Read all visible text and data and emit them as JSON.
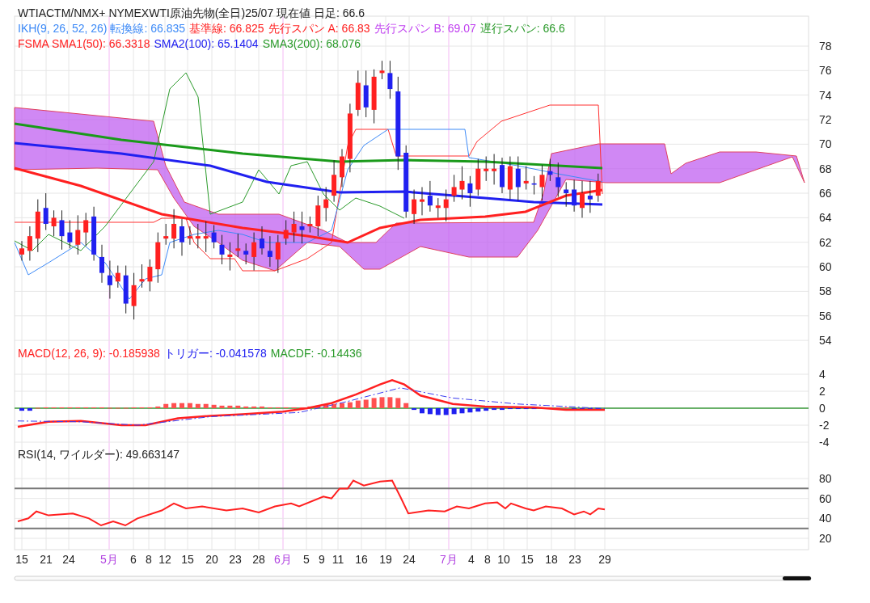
{
  "header": {
    "title": "WTIACTM/NMX+ NYMEXWTI原油先物(全日)25/07  現在値 日足: 66.6"
  },
  "ikh_legend": [
    {
      "text": "IKH(9, 26, 52, 26) 転換線: 66.835",
      "color": "#3d8af7"
    },
    {
      "text": "基準線: 66.825",
      "color": "#ff2020"
    },
    {
      "text": "先行スパン A: 66.83",
      "color": "#ff2020"
    },
    {
      "text": "先行スパン B: 69.07",
      "color": "#c040f0"
    },
    {
      "text": "遅行スパン: 66.6",
      "color": "#2a9a2a"
    }
  ],
  "sma_legend": [
    {
      "text": "FSMA SMA1(50): 66.3318",
      "color": "#ff2020"
    },
    {
      "text": "SMA2(100): 65.1404",
      "color": "#2020f0"
    },
    {
      "text": "SMA3(200): 68.076",
      "color": "#2a9a2a"
    }
  ],
  "price_axis": [
    "78",
    "76",
    "74",
    "72",
    "70",
    "68",
    "66",
    "64",
    "62",
    "60",
    "58",
    "56",
    "54"
  ],
  "macd_legend": [
    {
      "text": "MACD(12, 26, 9): -0.185938",
      "color": "#ff2020"
    },
    {
      "text": "トリガー: -0.041578",
      "color": "#2020f0"
    },
    {
      "text": "MACDF: -0.14436",
      "color": "#2a9a2a"
    }
  ],
  "macd_axis": [
    "4",
    "2",
    "0",
    "-2",
    "-4"
  ],
  "rsi_legend": {
    "text": "RSI(14, ワイルダー): 49.663147"
  },
  "rsi_axis": [
    "80",
    "60",
    "40",
    "20"
  ],
  "date_axis": [
    {
      "label": "15",
      "kind": "day"
    },
    {
      "label": "21",
      "kind": "day"
    },
    {
      "label": "24",
      "kind": "day"
    },
    {
      "label": "5月",
      "kind": "month"
    },
    {
      "label": "6",
      "kind": "day"
    },
    {
      "label": "8",
      "kind": "day"
    },
    {
      "label": "12",
      "kind": "day"
    },
    {
      "label": "15",
      "kind": "day"
    },
    {
      "label": "20",
      "kind": "day"
    },
    {
      "label": "23",
      "kind": "day"
    },
    {
      "label": "28",
      "kind": "day"
    },
    {
      "label": "6月",
      "kind": "month"
    },
    {
      "label": "5",
      "kind": "day"
    },
    {
      "label": "9",
      "kind": "day"
    },
    {
      "label": "11",
      "kind": "day"
    },
    {
      "label": "16",
      "kind": "day"
    },
    {
      "label": "19",
      "kind": "day"
    },
    {
      "label": "24",
      "kind": "day"
    },
    {
      "label": "7月",
      "kind": "month"
    },
    {
      "label": "4",
      "kind": "day"
    },
    {
      "label": "8",
      "kind": "day"
    },
    {
      "label": "10",
      "kind": "day"
    },
    {
      "label": "15",
      "kind": "day"
    },
    {
      "label": "18",
      "kind": "day"
    },
    {
      "label": "23",
      "kind": "day"
    },
    {
      "label": "29",
      "kind": "day"
    }
  ]
}
